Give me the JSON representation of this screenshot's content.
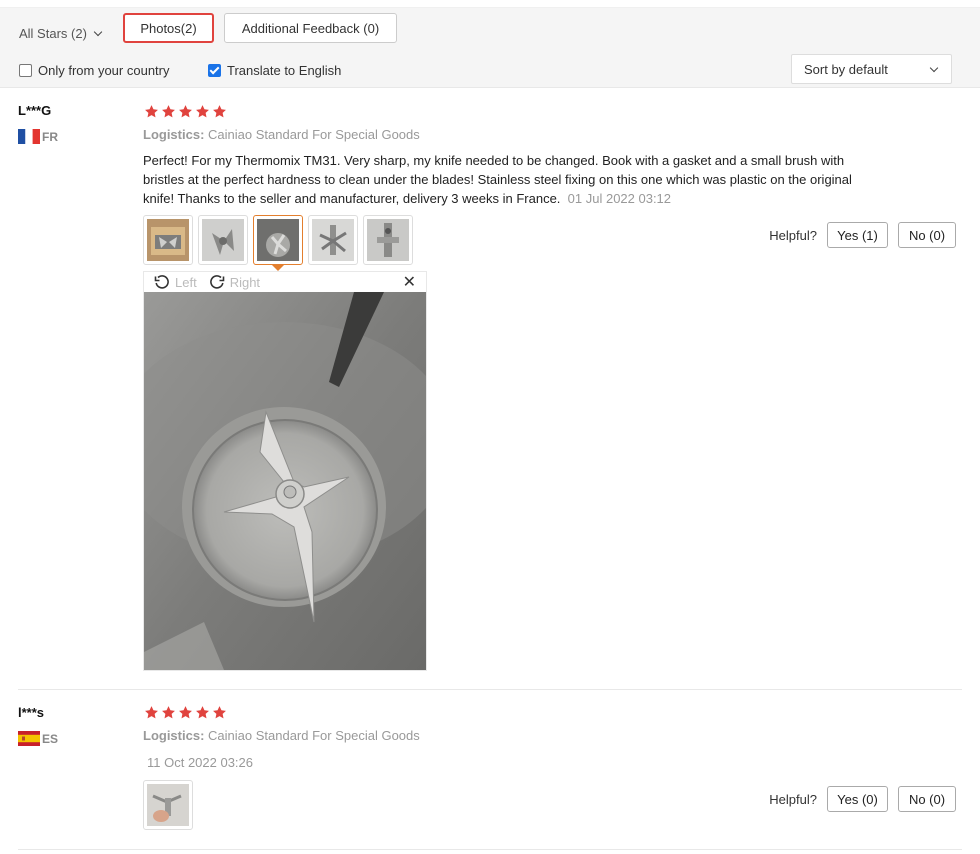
{
  "filters": {
    "stars_label": "All Stars (2)",
    "photos_tab": "Photos(2)",
    "feedback_tab": "Additional Feedback (0)",
    "only_country_label": "Only from your country",
    "only_country_checked": false,
    "translate_label": "Translate to English",
    "translate_checked": true,
    "sort_label": "Sort by default"
  },
  "viewer": {
    "left_label": "Left",
    "right_label": "Right",
    "close_glyph": "✕"
  },
  "reviews": [
    {
      "name": "L***G",
      "country": "FR",
      "rating": 5,
      "logistics_label": "Logistics:",
      "logistics_value": "Cainiao Standard For Special Goods",
      "text": "Perfect! For my Thermomix TM31. Very sharp, my knife needed to be changed. Book with a gasket and a small brush with bristles at the perfect hardness to clean under the blades! Stainless steel fixing on this one which was plastic on the original knife! Thanks to the seller and manufacturer, delivery 3 weeks in France.",
      "date": "01 Jul 2022 03:12",
      "helpful_label": "Helpful?",
      "yes_label": "Yes (1)",
      "no_label": "No (0)"
    },
    {
      "name": "l***s",
      "country": "ES",
      "rating": 5,
      "logistics_label": "Logistics:",
      "logistics_value": "Cainiao Standard For Special Goods",
      "date": "11 Oct 2022 03:26",
      "helpful_label": "Helpful?",
      "yes_label": "Yes (0)",
      "no_label": "No (0)"
    }
  ],
  "colors": {
    "star": "#e0433e",
    "active_tab_border": "#e0433e",
    "selected_thumb": "#e37f2e",
    "checkbox": "#1a73e8"
  }
}
